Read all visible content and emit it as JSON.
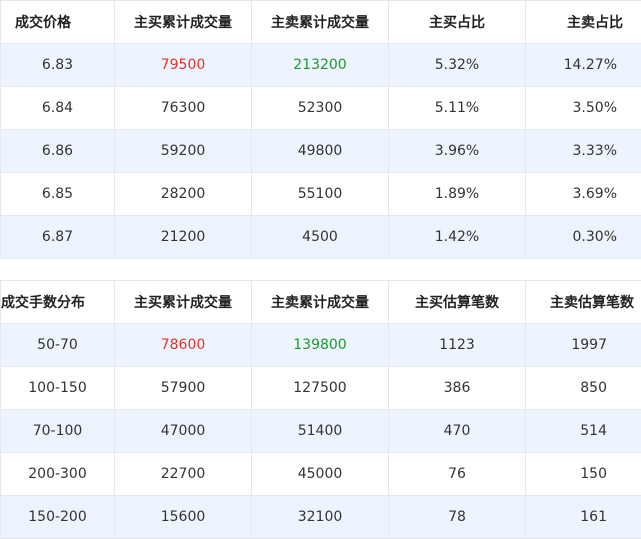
{
  "price_table": {
    "headers": [
      "成交价格",
      "主买累计成交量",
      "主卖累计成交量",
      "主买占比",
      "主卖占比"
    ],
    "rows": [
      [
        "6.83",
        "79500",
        "213200",
        "5.32%",
        "14.27%"
      ],
      [
        "6.84",
        "76300",
        "52300",
        "5.11%",
        "3.50%"
      ],
      [
        "6.86",
        "59200",
        "49800",
        "3.96%",
        "3.33%"
      ],
      [
        "6.85",
        "28200",
        "55100",
        "1.89%",
        "3.69%"
      ],
      [
        "6.87",
        "21200",
        "4500",
        "1.42%",
        "0.30%"
      ]
    ]
  },
  "lot_table": {
    "headers": [
      "成交手数分布",
      "主买累计成交量",
      "主卖累计成交量",
      "主买估算笔数",
      "主卖估算笔数"
    ],
    "rows": [
      [
        "50-70",
        "78600",
        "139800",
        "1123",
        "1997"
      ],
      [
        "100-150",
        "57900",
        "127500",
        "386",
        "850"
      ],
      [
        "70-100",
        "47000",
        "51400",
        "470",
        "514"
      ],
      [
        "200-300",
        "22700",
        "45000",
        "76",
        "150"
      ],
      [
        "150-200",
        "15600",
        "32100",
        "78",
        "161"
      ]
    ]
  },
  "colors": {
    "highlight_buy": "#e0352b",
    "highlight_sell": "#1a9a2e",
    "row_alt_bg": "#eef4fd"
  }
}
